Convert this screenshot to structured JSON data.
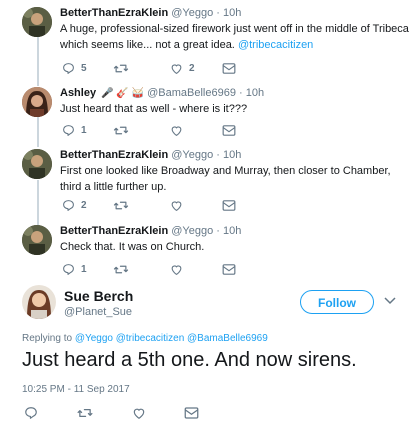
{
  "tweets": [
    {
      "name": "BetterThanEzraKlein",
      "handle": "@Yeggo",
      "time": "· 10h",
      "text_plain": "A huge, professional-sized firework just went off in the middle of Tribeca which seems like... not a great idea.",
      "mention": "@tribecacitizen",
      "reply_count": "5",
      "retweet_count": "",
      "like_count": "2"
    },
    {
      "name": "Ashley",
      "name_emoji": "🎤 🎸 🥁",
      "handle": "@BamaBelle6969",
      "time": "· 10h",
      "text": "Just heard that as well - where is it???",
      "reply_count": "1",
      "retweet_count": "",
      "like_count": ""
    },
    {
      "name": "BetterThanEzraKlein",
      "handle": "@Yeggo",
      "time": "· 10h",
      "text": "First one looked like Broadway and Murray, then closer to Chamber, third a little further up.",
      "reply_count": "2",
      "retweet_count": "",
      "like_count": ""
    },
    {
      "name": "BetterThanEzraKlein",
      "handle": "@Yeggo",
      "time": "· 10h",
      "text": "Check that. It was on Church.",
      "reply_count": "1",
      "retweet_count": "",
      "like_count": ""
    }
  ],
  "main": {
    "name": "Sue Berch",
    "handle": "@Planet_Sue",
    "follow_label": "Follow",
    "replying_prefix": "Replying to",
    "replying_to": "@Yeggo @tribecacitizen @BamaBelle6969",
    "text": "Just heard a 5th one. And now sirens.",
    "timestamp": "10:25 PM - 11 Sep 2017"
  },
  "colors": {
    "accent": "#1da1f2",
    "muted": "#657786",
    "text": "#14171a",
    "thread": "#ccd6dd"
  },
  "icons": [
    "reply-icon",
    "retweet-icon",
    "like-icon",
    "message-icon",
    "chevron-down-icon"
  ]
}
